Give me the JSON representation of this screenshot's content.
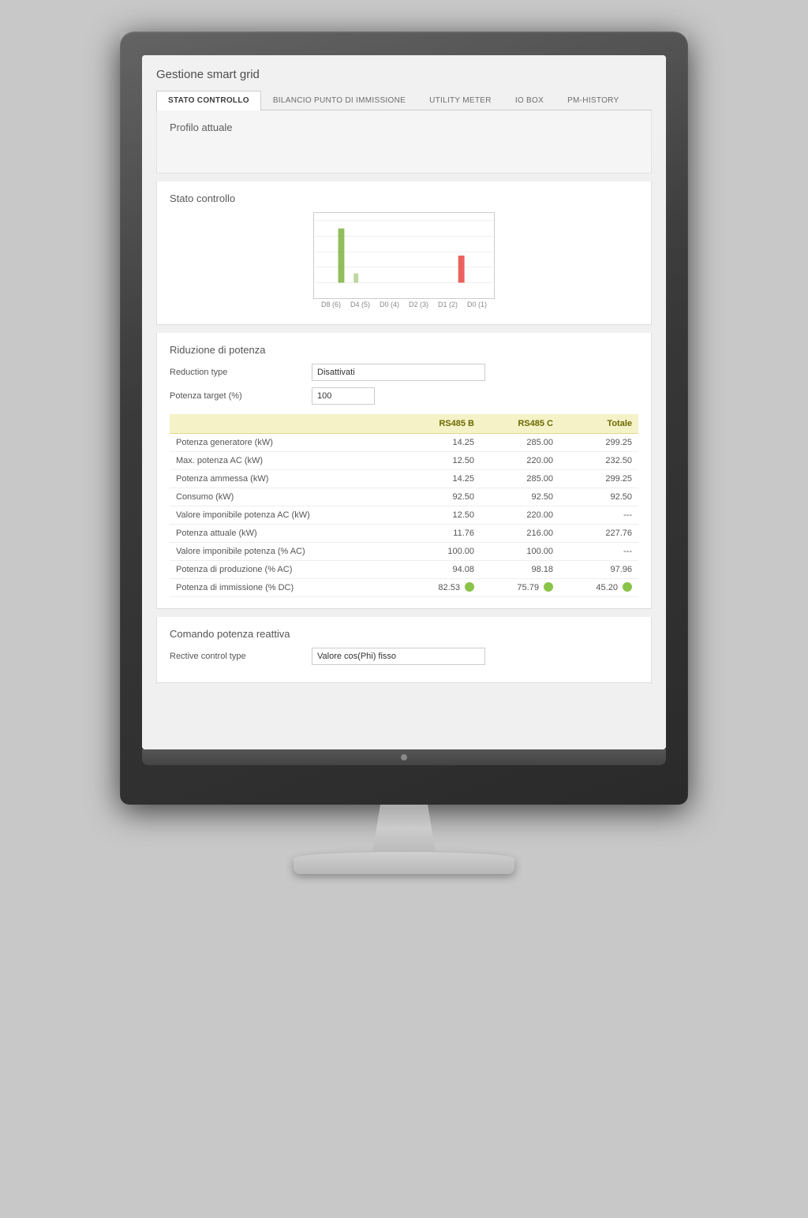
{
  "page": {
    "title": "Gestione smart grid"
  },
  "tabs": [
    {
      "id": "stato",
      "label": "STATO CONTROLLO",
      "active": true
    },
    {
      "id": "bilancio",
      "label": "BILANCIO PUNTO DI IMMISSIONE",
      "active": false
    },
    {
      "id": "utility",
      "label": "UTILITY METER",
      "active": false
    },
    {
      "id": "iobox",
      "label": "IO BOX",
      "active": false
    },
    {
      "id": "pmhistory",
      "label": "PM-HISTORY",
      "active": false
    }
  ],
  "sections": {
    "profilo": {
      "title": "Profilo attuale"
    },
    "stato": {
      "title": "Stato controllo"
    },
    "chart": {
      "labels": [
        "D8 (6)",
        "D4 (5)",
        "D0 (4)",
        "D2 (3)",
        "D1 (2)",
        "D0 (1)"
      ]
    },
    "riduzione": {
      "title": "Riduzione di potenza",
      "fields": [
        {
          "label": "Reduction type",
          "value": "Disattivati"
        },
        {
          "label": "Potenza target (%)",
          "value": "100"
        }
      ]
    },
    "table": {
      "headers": [
        "",
        "RS485 B",
        "RS485 C",
        "Totale"
      ],
      "rows": [
        {
          "label": "Potenza generatore (kW)",
          "b": "14.25",
          "c": "285.00",
          "tot": "299.25",
          "badge": false
        },
        {
          "label": "Max. potenza AC (kW)",
          "b": "12.50",
          "c": "220.00",
          "tot": "232.50",
          "badge": false
        },
        {
          "label": "Potenza ammessa (kW)",
          "b": "14.25",
          "c": "285.00",
          "tot": "299.25",
          "badge": false
        },
        {
          "label": "Consumo (kW)",
          "b": "92.50",
          "c": "92.50",
          "tot": "92.50",
          "badge": false
        },
        {
          "label": "Valore imponibile potenza AC (kW)",
          "b": "12.50",
          "c": "220.00",
          "tot": "---",
          "badge": false
        },
        {
          "label": "Potenza attuale (kW)",
          "b": "11.76",
          "c": "216.00",
          "tot": "227.76",
          "badge": false
        },
        {
          "label": "Valore imponibile potenza (% AC)",
          "b": "100.00",
          "c": "100.00",
          "tot": "---",
          "badge": false
        },
        {
          "label": "Potenza di produzione (% AC)",
          "b": "94.08",
          "c": "98.18",
          "tot": "97.96",
          "badge": false
        },
        {
          "label": "Potenza di immissione (% DC)",
          "b": "82.53",
          "c": "75.79",
          "tot": "45.20",
          "badge": true
        }
      ]
    },
    "comando": {
      "title": "Comando potenza reattiva",
      "fields": [
        {
          "label": "Rective control type",
          "value": "Valore cos(Phi) fisso"
        }
      ]
    }
  }
}
